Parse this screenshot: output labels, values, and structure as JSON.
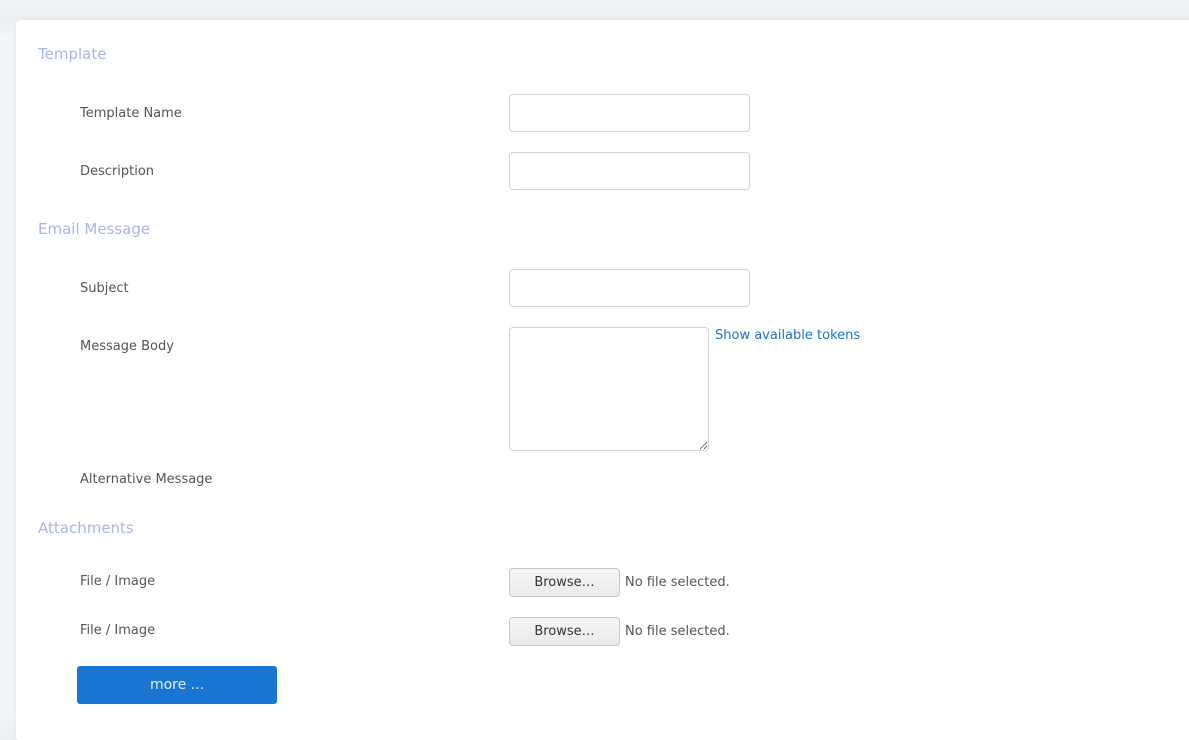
{
  "sections": {
    "template": "Template",
    "email": "Email Message",
    "attachments": "Attachments"
  },
  "fields": {
    "template_name": {
      "label": "Template Name",
      "value": "",
      "placeholder": ""
    },
    "description": {
      "label": "Description",
      "value": "",
      "placeholder": ""
    },
    "subject": {
      "label": "Subject",
      "value": "",
      "placeholder": ""
    },
    "message_body": {
      "label": "Message Body",
      "value": ""
    },
    "alternative_message": {
      "label": "Alternative Message"
    }
  },
  "tokens_link": "Show available tokens",
  "attachments": [
    {
      "label": "File / Image",
      "button": "Browse…",
      "status": "No file selected."
    },
    {
      "label": "File / Image",
      "button": "Browse…",
      "status": "No file selected."
    }
  ],
  "more_button": "more ...",
  "colors": {
    "section_title": "#a9b4ea",
    "link": "#1c72d2",
    "primary_button": "#1b76d3"
  }
}
